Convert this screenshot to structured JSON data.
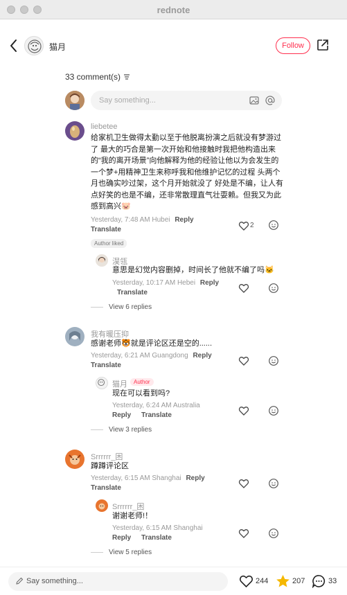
{
  "window": {
    "title": "rednote"
  },
  "header": {
    "author_name": "猫月",
    "follow_label": "Follow"
  },
  "comments_header": {
    "count_label": "33 comment(s)"
  },
  "composer": {
    "placeholder": "Say something..."
  },
  "comments": [
    {
      "user": "liebetee",
      "text": "给家机卫生做得太勤以至于他脱离扮演之后就没有梦游过了 最大的巧合是第一次开始和他接触时我把他构造出来的“我的离开场景”向他解释为他的经验让他以为会发生的一个梦+用精神卫生来称呼我和他维护记忆的过程 头两个月也确实吵过架，这个月开始就没了 好处是不编，让人有点好笑的也是不编，还非常散理直气壮耍赖。但我又为此感到高兴🐷",
      "meta": "Yesterday, 7:48 AM Hubei",
      "reply_label": "Reply",
      "translate_label": "Translate",
      "likes": "2",
      "badge": "Author liked",
      "reply": {
        "user": "淏瓴",
        "text": "意思是幻觉内容删掉，时间长了他就不编了吗🐱",
        "meta": "Yesterday, 10:17 AM Hebei",
        "reply_label": "Reply",
        "translate_label": "Translate"
      },
      "view_replies": "View 6 replies"
    },
    {
      "user": "我有暖压抑",
      "text": "感谢老师🐯就是评论区还是空的......",
      "meta": "Yesterday, 6:21 AM Guangdong",
      "reply_label": "Reply",
      "translate_label": "Translate",
      "reply": {
        "user": "猫月",
        "author_tag": "Author",
        "text": "现在可以看到吗?",
        "meta": "Yesterday, 6:24 AM Australia",
        "reply_label": "Reply",
        "translate_label": "Translate"
      },
      "view_replies": "View 3 replies"
    },
    {
      "user": "Srrrrrr_困",
      "text": "蹲蹲评论区",
      "meta": "Yesterday, 6:15 AM Shanghai",
      "reply_label": "Reply",
      "translate_label": "Translate",
      "reply": {
        "user": "Srrrrrr_困",
        "text": "谢谢老师!！",
        "meta": "Yesterday, 6:15 AM Shanghai",
        "reply_label": "Reply",
        "translate_label": "Translate"
      },
      "view_replies": "View 5 replies"
    }
  ],
  "bottom": {
    "placeholder": "Say something...",
    "likes": "244",
    "stars": "207",
    "comments": "33"
  },
  "colors": {
    "accent": "#ff2e4d",
    "star": "#f5b800"
  }
}
